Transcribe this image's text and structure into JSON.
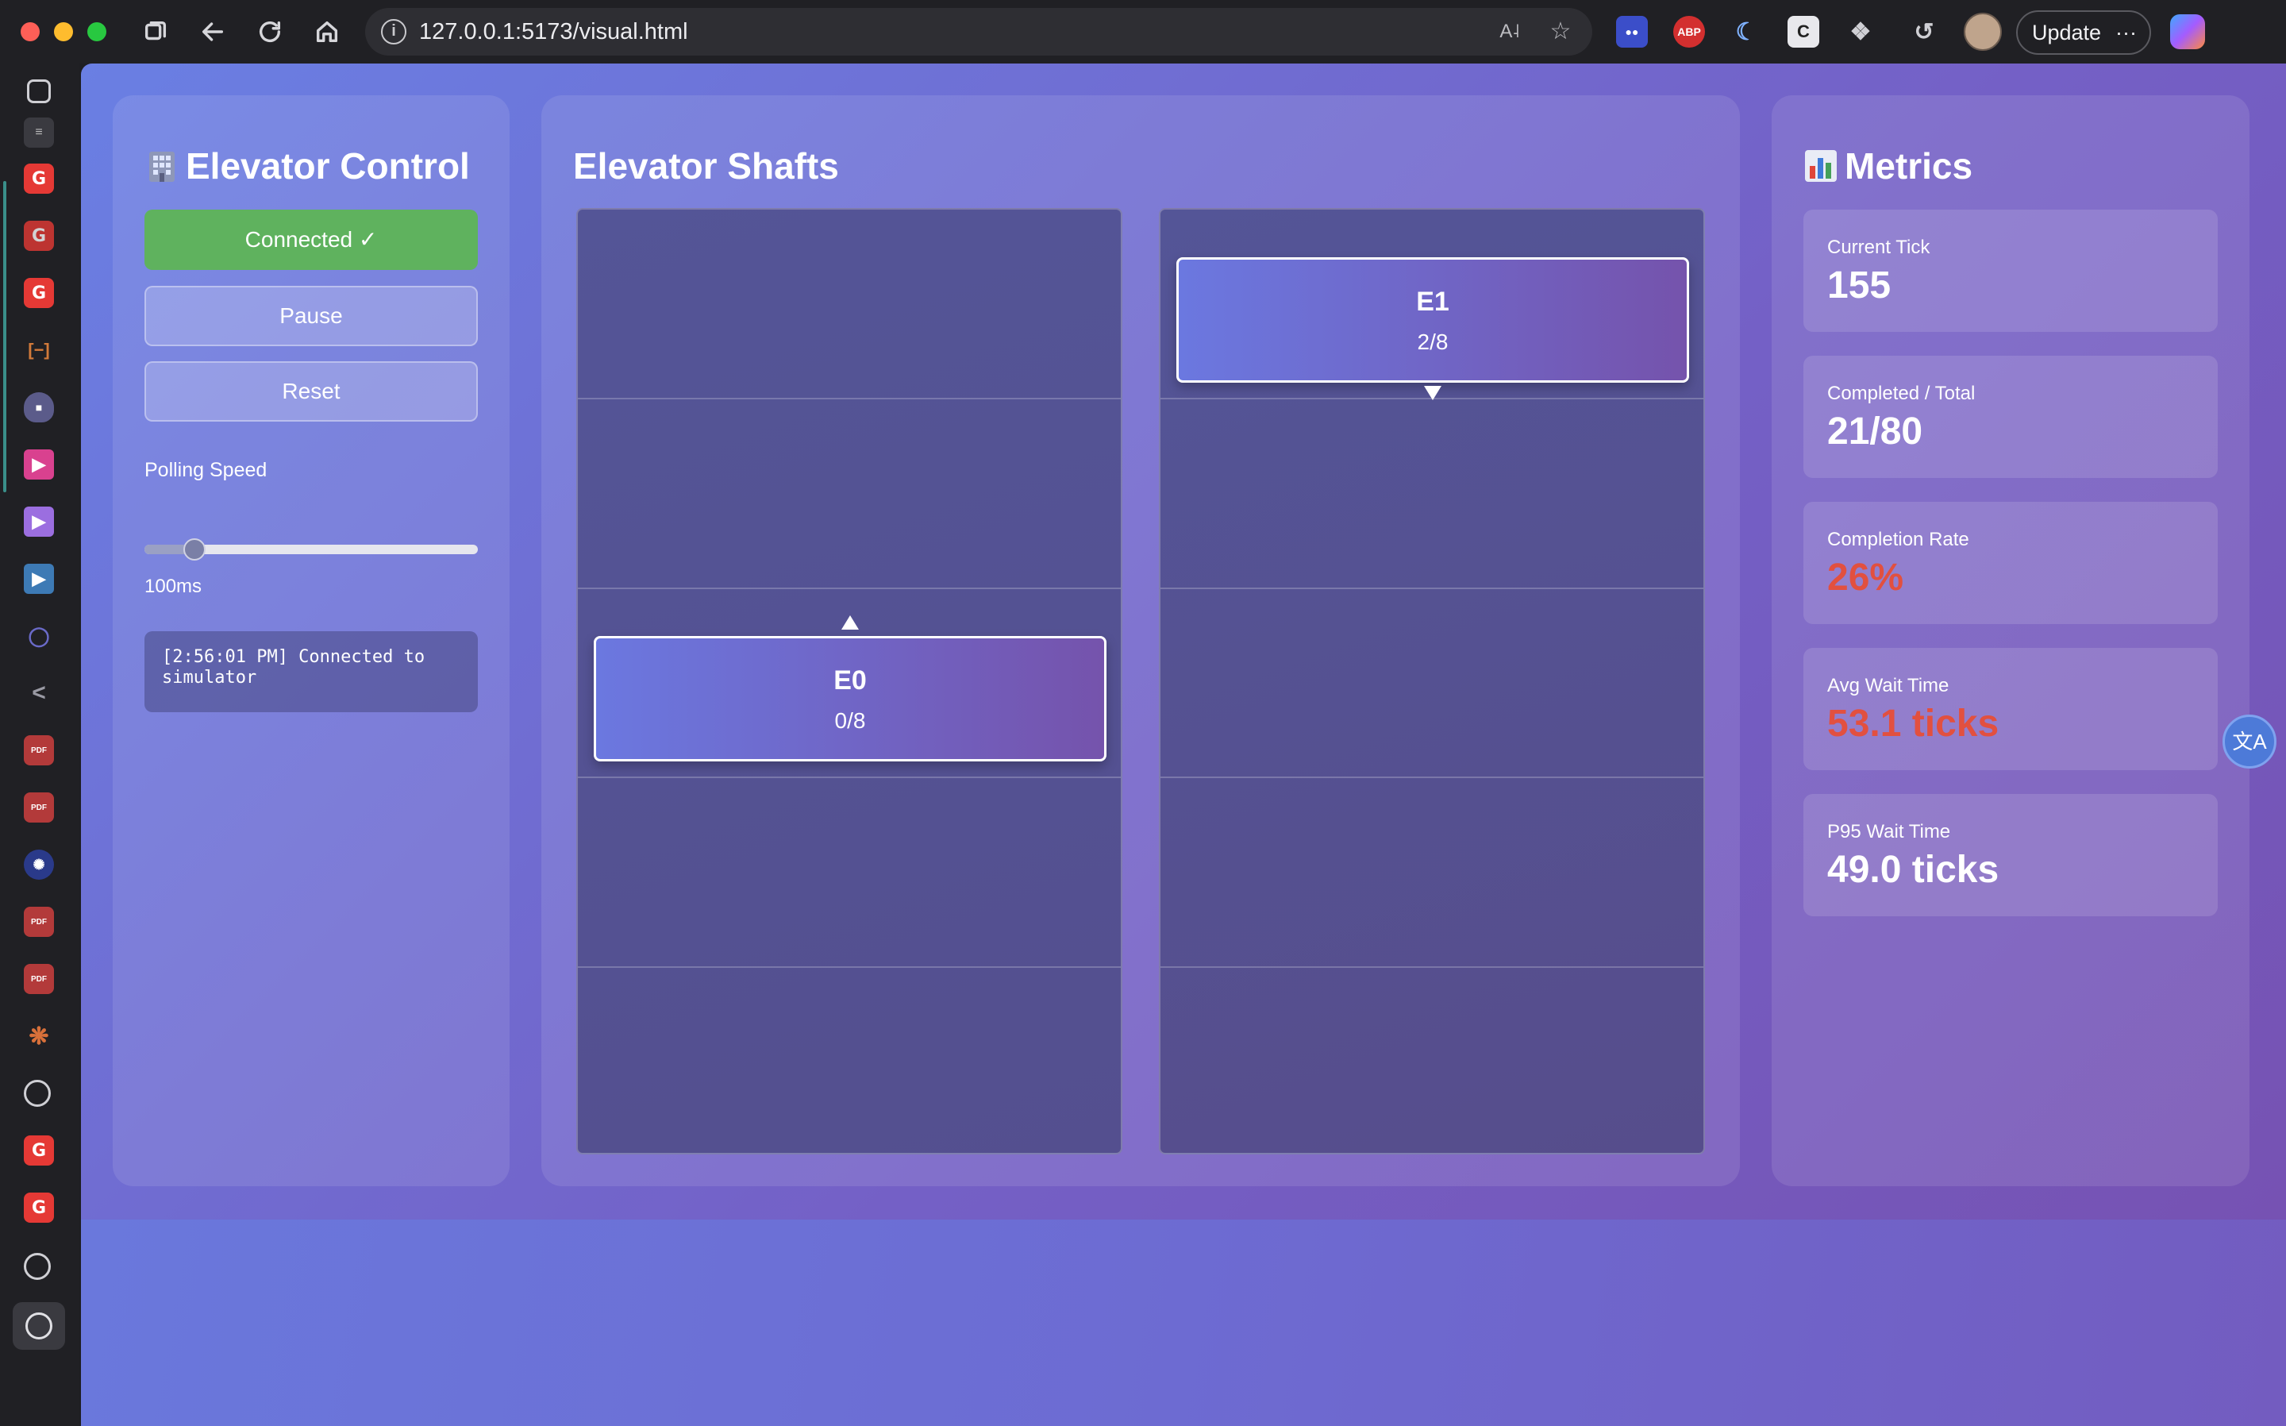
{
  "browser": {
    "url": "127.0.0.1:5173/visual.html",
    "update_label": "Update",
    "more_label": "···",
    "ext_abp": "ABP"
  },
  "control": {
    "title": "Elevator Control",
    "connected_label": "Connected ✓",
    "pause_label": "Pause",
    "reset_label": "Reset",
    "polling_label": "Polling Speed",
    "polling_value": "100ms",
    "polling_fraction": 0.15,
    "log_message": "[2:56:01 PM] Connected to simulator"
  },
  "shafts": {
    "title": "Elevator Shafts",
    "floors": 5,
    "elevators": [
      {
        "name": "E0",
        "load": "0/8",
        "direction": "up",
        "floor": 2
      },
      {
        "name": "E1",
        "load": "2/8",
        "direction": "down",
        "floor": 4
      }
    ]
  },
  "metrics": {
    "title": "Metrics",
    "cards": [
      {
        "label": "Current Tick",
        "value": "155",
        "status": "normal"
      },
      {
        "label": "Completed / Total",
        "value": "21/80",
        "status": "normal"
      },
      {
        "label": "Completion Rate",
        "value": "26%",
        "status": "warn"
      },
      {
        "label": "Avg Wait Time",
        "value": "53.1 ticks",
        "status": "warn"
      },
      {
        "label": "P95 Wait Time",
        "value": "49.0 ticks",
        "status": "normal"
      }
    ]
  },
  "colors": {
    "connected": "#5fb25e",
    "warn": "#e2503f",
    "accent_start": "#6a7fe3",
    "accent_end": "#7650b0"
  }
}
